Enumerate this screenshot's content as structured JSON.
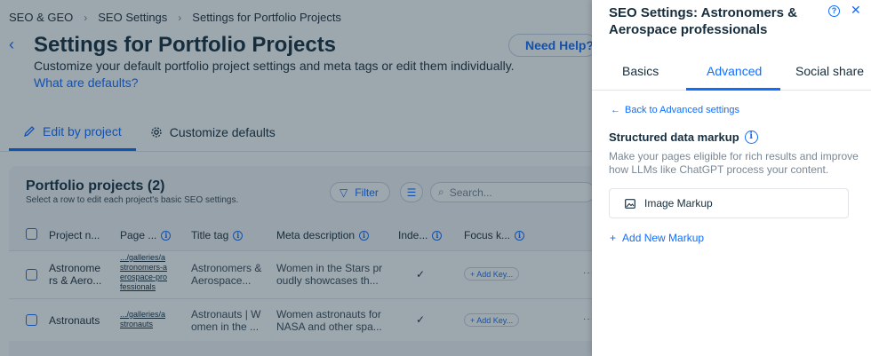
{
  "breadcrumbs": [
    "SEO & GEO",
    "SEO Settings",
    "Settings for Portfolio Projects"
  ],
  "page": {
    "title": "Settings for Portfolio Projects",
    "subtitle": "Customize your default portfolio project settings and meta tags or edit them individually.",
    "defaults_link": "What are defaults?",
    "help_button": "Need Help?"
  },
  "page_tabs": [
    {
      "label": "Edit by project",
      "icon": "pencil-icon",
      "active": true
    },
    {
      "label": "Customize defaults",
      "icon": "gear-icon",
      "active": false
    }
  ],
  "table_card": {
    "title": "Portfolio projects (2)",
    "subtitle": "Select a row to edit each project's basic SEO settings.",
    "filter_label": "Filter",
    "search_placeholder": "Search...",
    "columns": [
      "Project n...",
      "Page ...",
      "Title tag",
      "Meta description",
      "Inde...",
      "Focus k..."
    ],
    "rows": [
      {
        "name": "Astronome rs & Aero...",
        "page_url": ".../galleries/a stronomers-a erospace-pro fessionals",
        "title_tag": "Astronomers & Aerospace...",
        "meta": "Women in the Stars pr oudly showcases th...",
        "indexed": "✓",
        "focus": "+ Add Key..."
      },
      {
        "name": "Astronauts",
        "page_url": ".../galleries/a stronauts",
        "title_tag": "Astronauts | W omen in the ...",
        "meta": "Women astronauts for NASA and other spa...",
        "indexed": "✓",
        "focus": "+ Add Key..."
      }
    ]
  },
  "panel": {
    "title": "SEO Settings: Astronomers & Aerospace professionals",
    "tabs": [
      "Basics",
      "Advanced",
      "Social share"
    ],
    "active_tab": "Advanced",
    "back_link": "Back to Advanced settings",
    "section_title": "Structured data markup",
    "section_desc": "Make your pages eligible for rich results and improve how LLMs like ChatGPT process your content.",
    "markup_item": "Image Markup",
    "add_markup": "Add New Markup"
  },
  "colors": {
    "accent": "#116dff",
    "text": "#162d3d",
    "overlay": "rgba(22,45,61,0.42)"
  }
}
